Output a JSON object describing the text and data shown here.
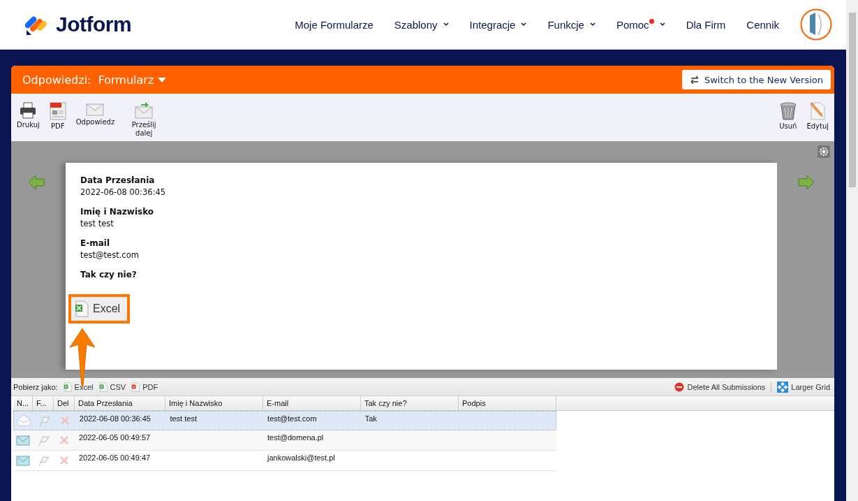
{
  "brand": "Jotform",
  "nav": [
    {
      "label": "Moje Formularze",
      "dropdown": false,
      "dot": false
    },
    {
      "label": "Szablony",
      "dropdown": true,
      "dot": false
    },
    {
      "label": "Integracje",
      "dropdown": true,
      "dot": false
    },
    {
      "label": "Funkcje",
      "dropdown": true,
      "dot": false
    },
    {
      "label": "Pomoc",
      "dropdown": true,
      "dot": true
    },
    {
      "label": "Dla Firm",
      "dropdown": false,
      "dot": false
    },
    {
      "label": "Cennik",
      "dropdown": false,
      "dot": false
    }
  ],
  "panel": {
    "title": "Odpowiedzi:",
    "form_name": "Formularz",
    "switch_button": "Switch to the New Version"
  },
  "toolbar_left": [
    {
      "kind": "print",
      "label": "Drukuj"
    },
    {
      "kind": "pdf",
      "label": "PDF"
    },
    {
      "kind": "reply",
      "label": "Odpowiedz"
    },
    {
      "kind": "forward",
      "label": "Prześlij dalej"
    }
  ],
  "toolbar_right": [
    {
      "kind": "trash",
      "label": "Usuń"
    },
    {
      "kind": "edit",
      "label": "Edytuj"
    }
  ],
  "submission": [
    {
      "label": "Data Przesłania",
      "value": "2022-06-08 00:36:45"
    },
    {
      "label": "Imię i Nazwisko",
      "value": "test test"
    },
    {
      "label": "E-mail",
      "value": "test@test.com"
    },
    {
      "label": "Tak czy nie?"
    }
  ],
  "callout": {
    "label": "Excel"
  },
  "export": {
    "label": "Pobierz jako:",
    "formats": [
      {
        "kind": "excel",
        "label": "Excel"
      },
      {
        "kind": "csv",
        "label": "CSV"
      },
      {
        "kind": "pdf",
        "label": "PDF"
      }
    ],
    "delete_all": "Delete All Submissions",
    "larger_grid": "Larger Grid"
  },
  "table": {
    "columns": [
      "N...",
      "F...",
      "Del",
      "Data Przesłania",
      "Imię i Nazwisko",
      "E-mail",
      "Tak czy nie?",
      "Podpis"
    ],
    "rows": [
      {
        "selected": true,
        "read": true,
        "date": "2022-06-08 00:36:45",
        "name": "test test",
        "email": "test@test.com",
        "answer": "Tak"
      },
      {
        "selected": false,
        "read": false,
        "date": "2022-06-05 00:49:57",
        "email": "test@domena.pl"
      },
      {
        "selected": false,
        "read": false,
        "date": "2022-06-05 00:49:47",
        "email": "jankowalski@test.pl"
      }
    ]
  }
}
